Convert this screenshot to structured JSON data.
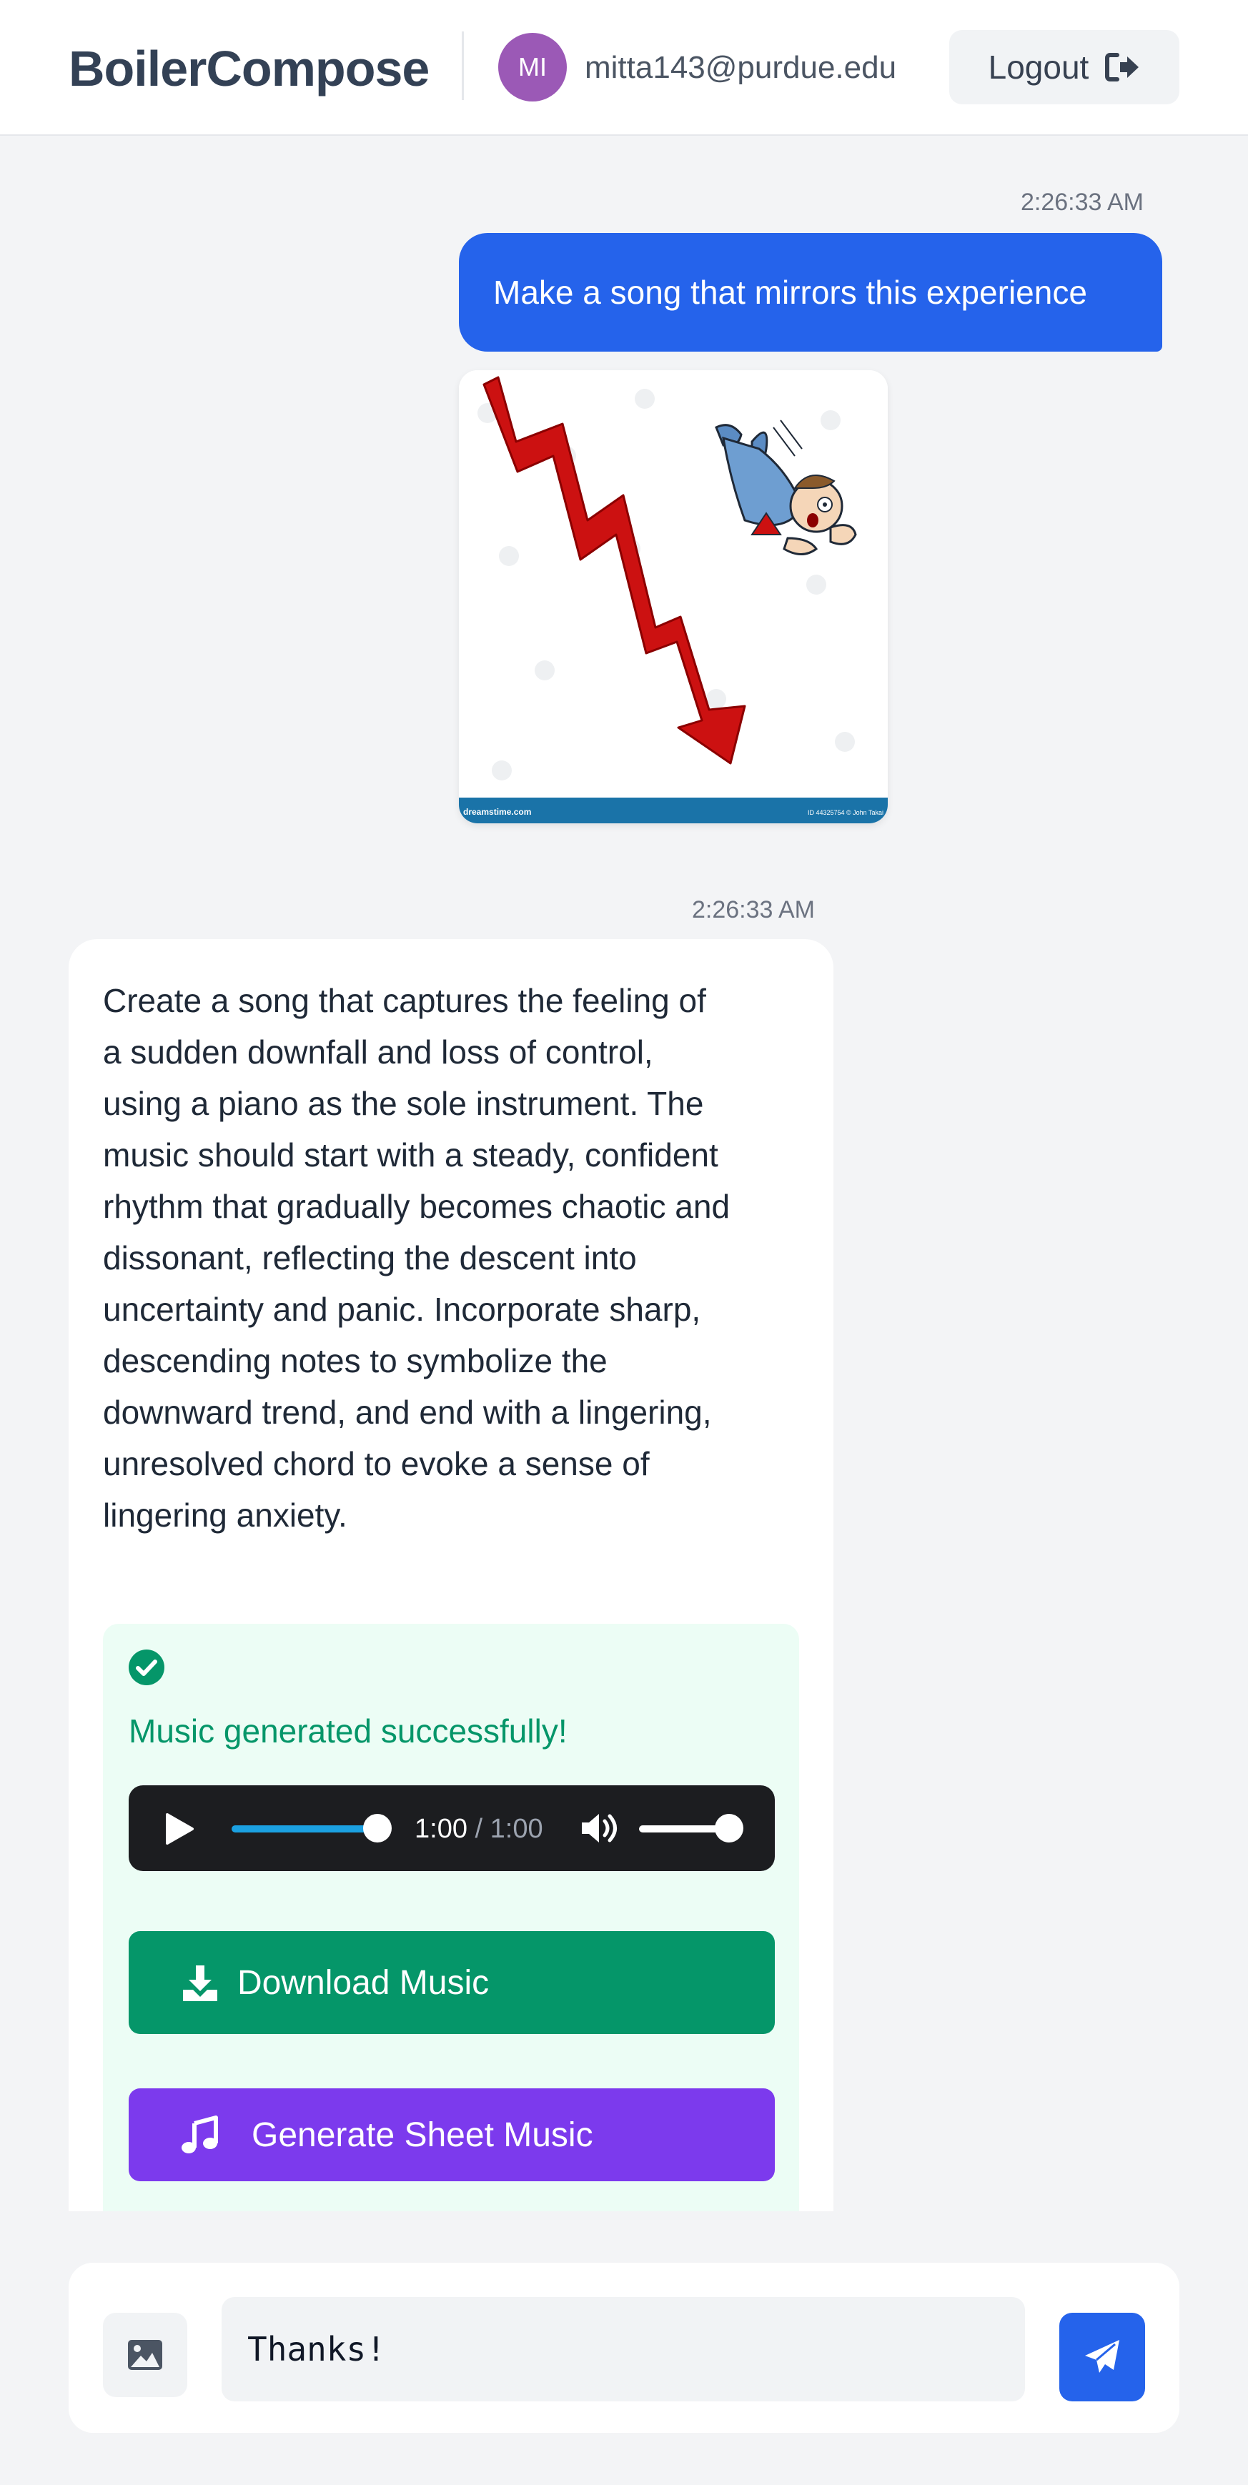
{
  "header": {
    "brand": "BoilerCompose",
    "avatar_initials": "MI",
    "avatar_color": "#9b59b6",
    "email": "mitta143@purdue.edu",
    "logout_label": "Logout",
    "logout_icon": "sign-out-icon"
  },
  "chat": {
    "user_message": {
      "timestamp": "2:26:33 AM",
      "text": "Make a song that mirrors this experience",
      "image": {
        "description_icon": "falling-businessman-downward-arrow-illustration",
        "watermark_left": "dreamstime.com",
        "watermark_right": "ID 44325754 © John Takai"
      }
    },
    "bot_message": {
      "timestamp": "2:26:33 AM",
      "text": "Create a song that captures the feeling of a sudden downfall and loss of control, using a piano as the sole instrument. The music should start with a steady, confident rhythm that gradually becomes chaotic and dissonant, reflecting the descent into uncertainty and panic. Incorporate sharp, descending notes to symbolize the downward trend, and end with a lingering, unresolved chord to evoke a sense of lingering anxiety.",
      "status": {
        "icon": "check-circle-icon",
        "text": "Music generated successfully!"
      },
      "player": {
        "current_time": "1:00",
        "separator": "/",
        "total_time": "1:00",
        "progress": 1.0,
        "volume": 1.0
      },
      "download_label": "Download Music",
      "sheet_music_label": "Generate Sheet Music"
    }
  },
  "composer": {
    "input_value": "Thanks!",
    "image_button_icon": "image-icon",
    "send_button_icon": "paper-plane-icon"
  },
  "colors": {
    "primary": "#2563eb",
    "success": "#059669",
    "purple": "#7c3aed",
    "background": "#f3f4f6"
  }
}
